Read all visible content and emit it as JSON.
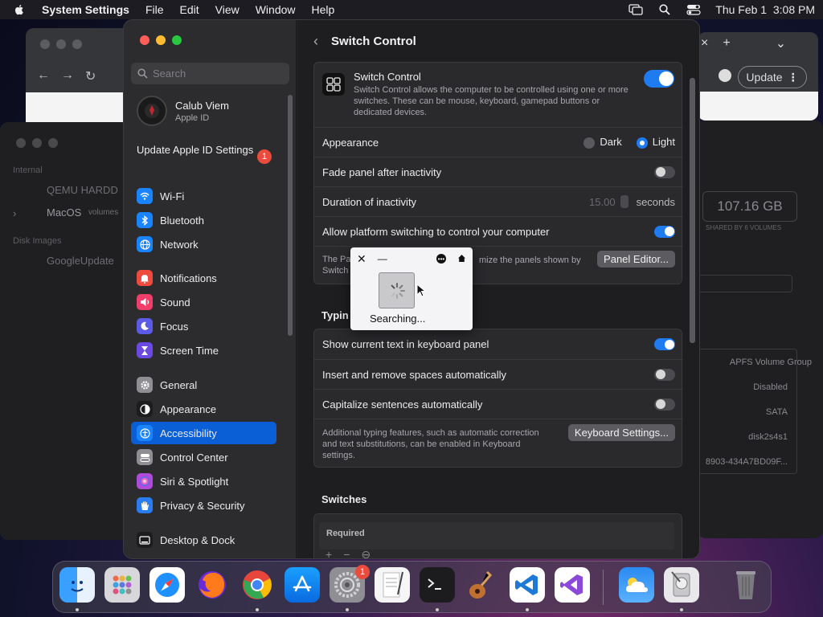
{
  "menubar": {
    "app": "System Settings",
    "items": [
      "File",
      "Edit",
      "View",
      "Window",
      "Help"
    ],
    "clock": "Thu Feb 1  3:08 PM"
  },
  "background": {
    "chrome_update": "Update",
    "disk": {
      "internal": "Internal",
      "qemu": "QEMU HARDD",
      "macos": "MacOS",
      "volumes": "volumes",
      "disk_images": "Disk Images",
      "google": "GoogleUpdate",
      "capacity": "107.16 GB",
      "shared": "SHARED BY 6 VOLUMES",
      "apfs": "APFS Volume Group",
      "disabled": "Disabled",
      "sata": "SATA",
      "disk_id": "disk2s4s1",
      "uuid": "8903-434A7BD09F..."
    }
  },
  "sidebar": {
    "search_placeholder": "Search",
    "account": {
      "name": "Calub Viem",
      "sub": "Apple ID"
    },
    "update": {
      "label": "Update Apple ID Settings",
      "badge": "1"
    },
    "items": [
      {
        "label": "Wi-Fi",
        "color": "#1a84ff",
        "icon": "wifi-icon"
      },
      {
        "label": "Bluetooth",
        "color": "#1a84ff",
        "icon": "bluetooth-icon"
      },
      {
        "label": "Network",
        "color": "#1a84ff",
        "icon": "globe-icon"
      },
      {
        "label": "Notifications",
        "color": "#ef4a3e",
        "icon": "bell-icon"
      },
      {
        "label": "Sound",
        "color": "#ef3e6a",
        "icon": "speaker-icon"
      },
      {
        "label": "Focus",
        "color": "#5b5be6",
        "icon": "moon-icon"
      },
      {
        "label": "Screen Time",
        "color": "#6a4ae0",
        "icon": "hourglass-icon"
      },
      {
        "label": "General",
        "color": "#8e8e93",
        "icon": "gear-icon"
      },
      {
        "label": "Appearance",
        "color": "#1c1c1e",
        "icon": "appearance-icon"
      },
      {
        "label": "Accessibility",
        "color": "#1a84ff",
        "icon": "accessibility-icon"
      },
      {
        "label": "Control Center",
        "color": "#8e8e93",
        "icon": "control-center-icon"
      },
      {
        "label": "Siri & Spotlight",
        "color": "#b04ad8",
        "icon": "siri-icon"
      },
      {
        "label": "Privacy & Security",
        "color": "#2a7df0",
        "icon": "hand-icon"
      },
      {
        "label": "Desktop & Dock",
        "color": "#1c1c1e",
        "icon": "dock-icon"
      }
    ]
  },
  "content": {
    "title": "Switch Control",
    "switch_control": {
      "label": "Switch Control",
      "desc": "Switch Control allows the computer to be controlled using one or more switches. These can be mouse, keyboard, gamepad buttons or dedicated devices."
    },
    "appearance": {
      "label": "Appearance",
      "dark": "Dark",
      "light": "Light"
    },
    "fade": "Fade panel after inactivity",
    "duration": {
      "label": "Duration of inactivity",
      "value": "15.00",
      "unit": "seconds"
    },
    "platform": "Allow platform switching to control your computer",
    "panel_note_left": "The Pa",
    "panel_note_left2": "Switch",
    "panel_note_right": "mize the panels shown by",
    "panel_editor": "Panel Editor...",
    "typing_h": "Typin",
    "show_text": "Show current text in keyboard panel",
    "insert_spaces": "Insert and remove spaces automatically",
    "capitalize": "Capitalize sentences automatically",
    "typing_note": "Additional typing features, such as automatic correction and text substitutions, can be enabled in Keyboard settings.",
    "keyboard_settings": "Keyboard Settings...",
    "switches_h": "Switches",
    "required": "Required"
  },
  "popup": {
    "status": "Searching..."
  },
  "dock": {
    "apps": [
      "Finder",
      "Launchpad",
      "Safari",
      "Firefox",
      "Chrome",
      "App Store",
      "System Settings",
      "TextEdit",
      "Terminal",
      "GarageBand",
      "VS Code",
      "Visual Studio",
      "Weather",
      "Disk Utility",
      "Trash"
    ],
    "settings_badge": "1"
  }
}
